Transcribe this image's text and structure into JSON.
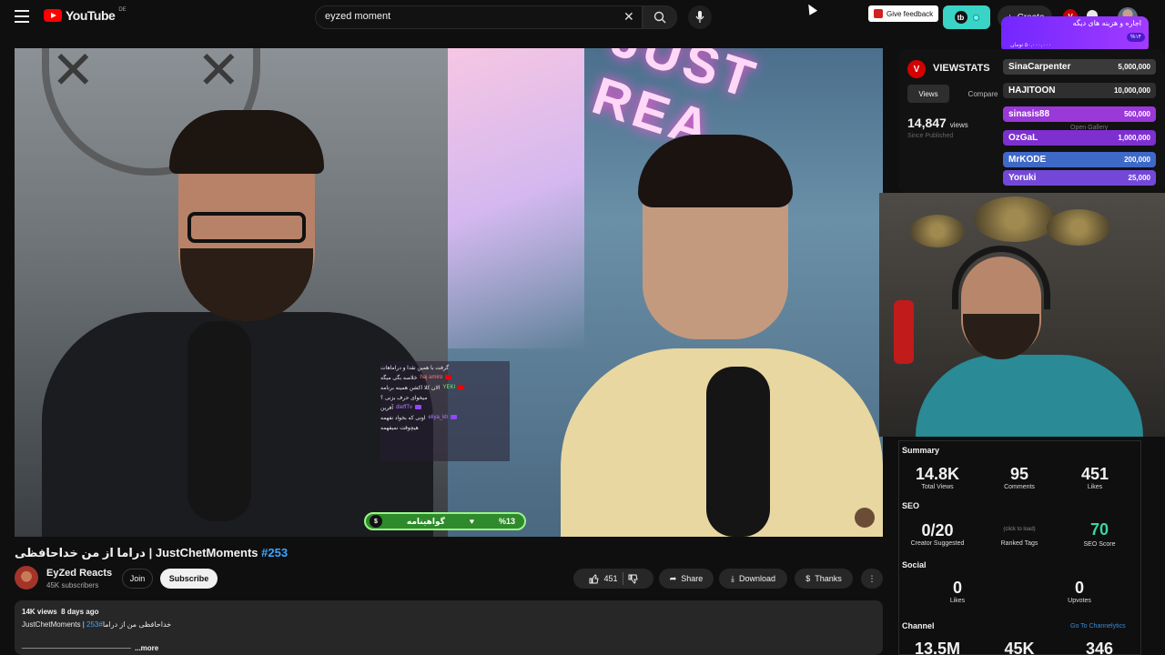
{
  "header": {
    "logo_text": "YouTube",
    "country_code": "DE",
    "search_value": "eyzed moment",
    "feedback_label": "Give feedback",
    "ext_badge": "tb",
    "create_label": "Create",
    "viewstats_badge": "V"
  },
  "donation_overlay": {
    "title": "اجاره و هزینه های دیگه",
    "percent": "%۱۴",
    "amount": "۵۰,۰۰۰,۰۰۰ تومان"
  },
  "video_overlay": {
    "neon_text": "JUST REA",
    "chat_header": "گرفت با همین نقدا و دراماهات",
    "chat": [
      {
        "name": "haj amiro",
        "text": "خلاصه بگی میگه"
      },
      {
        "name": "YEKI",
        "text": "الان کلا اکشن همینه برنامه"
      },
      {
        "name": "",
        "text": "میخوای حرف بزنی ؟"
      },
      {
        "name": "dieffTv",
        "text": "آفرین"
      },
      {
        "name": "eliya_kh",
        "text": "اونی که بخواد نفهمه"
      },
      {
        "name": "",
        "text": "هیچوقت نمیفهمه"
      }
    ],
    "goal_label": "گواهینامه",
    "goal_percent": "%13",
    "goal_icon": "$"
  },
  "video": {
    "title_main": "دراما از من خداحافظی | JustChetMoments ",
    "title_tag": "#253",
    "channel_name": "EyZed Reacts",
    "subscribers": "45K subscribers",
    "join_label": "Join",
    "subscribe_label": "Subscribe",
    "likes": "451",
    "share_label": "Share",
    "download_label": "Download",
    "thanks_label": "Thanks",
    "more_icon": "⋮"
  },
  "description": {
    "views": "14K views",
    "age": "8 days ago",
    "line_main": "JustChetMoments | خداحافظی من از دراما",
    "line_tag": "#253",
    "more_label": "...more"
  },
  "viewstats": {
    "title": "VIEWSTATS",
    "tab_views": "Views",
    "tab_compare": "Compare",
    "views_count": "14,847",
    "views_unit": "views",
    "since": "Since Published",
    "hidden_label": "Open Gallery"
  },
  "leaderboard": [
    {
      "name": "SinaCarpenter",
      "amount": "5,000,000",
      "color": "#3a3a3a"
    },
    {
      "name": "HAJITOON",
      "amount": "10,000,000",
      "color": "#2f2f2f"
    },
    {
      "name": "sinasis88",
      "amount": "500,000",
      "color": "#9a38d8"
    },
    {
      "name": "OzGaL",
      "amount": "1,000,000",
      "color": "#7d2fd0"
    },
    {
      "name": "MrKODE",
      "amount": "200,000",
      "color": "#3f69c8"
    },
    {
      "name": "Yoruki",
      "amount": "25,000",
      "color": "#7348d8"
    }
  ],
  "stats": {
    "summary_label": "Summary",
    "total_views": "14.8K",
    "total_views_label": "Total Views",
    "comments": "95",
    "comments_label": "Comments",
    "likes": "451",
    "likes_label": "Likes",
    "seo_label": "SEO",
    "creator_suggested": "0/20",
    "creator_suggested_label": "Creator Suggested",
    "ranked_tags_hint": "(click to load)",
    "ranked_tags_label": "Ranked Tags",
    "seo_score": "70",
    "seo_score_label": "SEO Score",
    "social_label": "Social",
    "social_likes": "0",
    "social_likes_label": "Likes",
    "upvotes": "0",
    "upvotes_label": "Upvotes",
    "channel_label": "Channel",
    "channel_link": "Go To Channelytics",
    "ch_val1": "13.5M",
    "ch_val2": "45K",
    "ch_val3": "346"
  }
}
